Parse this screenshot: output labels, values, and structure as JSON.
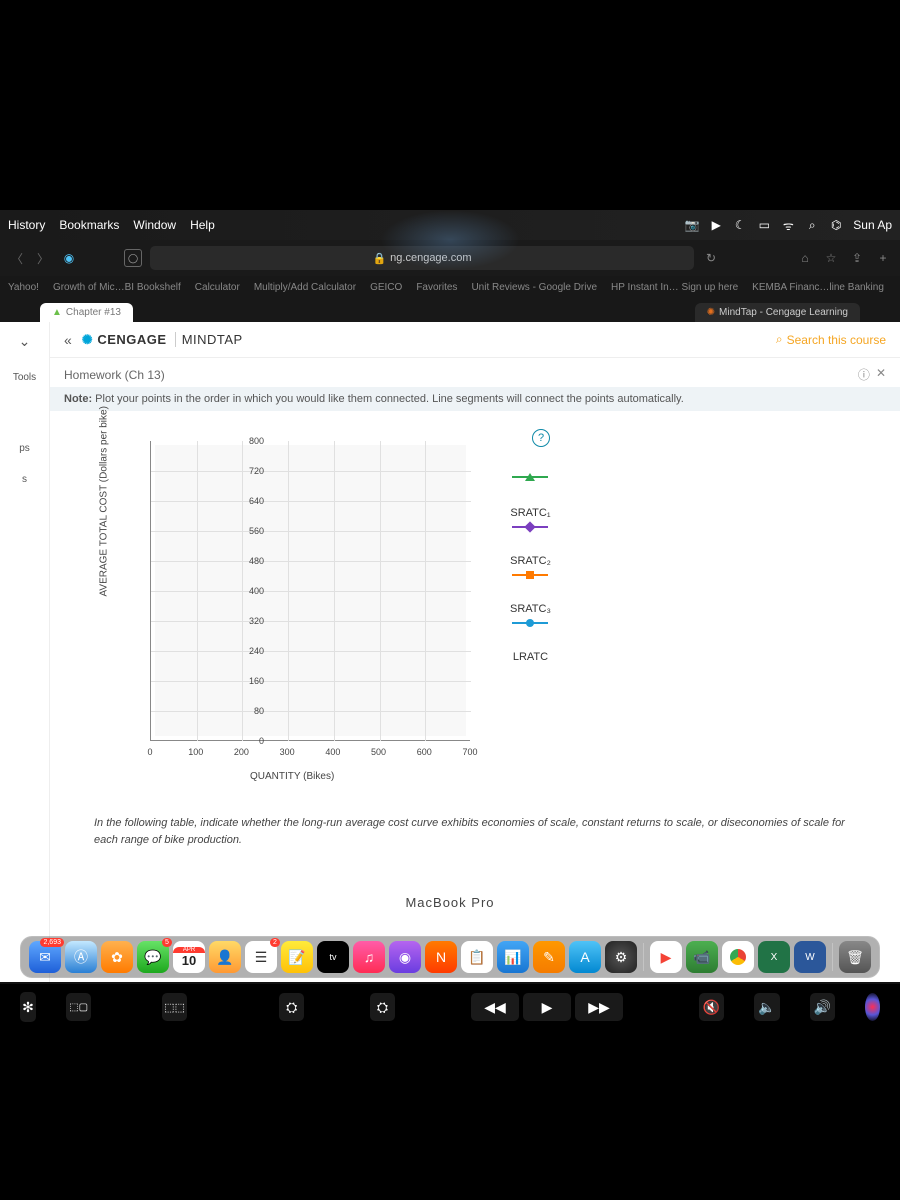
{
  "menubar": {
    "items": [
      "History",
      "Bookmarks",
      "Window",
      "Help"
    ],
    "clock": "Sun Ap"
  },
  "browser": {
    "address": "ng.cengage.com",
    "lock": "🔒",
    "reload": "↻"
  },
  "bookmarks": [
    "Yahoo!",
    "Growth of Mic…BI Bookshelf",
    "Calculator",
    "Multiply/Add Calculator",
    "GEICO",
    "Favorites",
    "Unit Reviews - Google Drive",
    "HP Instant In… Sign up here",
    "KEMBA Financ…line Banking"
  ],
  "tabs": {
    "active": "Chapter #13",
    "second": "MindTap - Cengage Learning"
  },
  "mindtap": {
    "brand_left": "CENGAGE",
    "brand_right": "MINDTAP",
    "search": "Search this course"
  },
  "sidebar": {
    "tools": "Tools",
    "label1": "ps",
    "label2": "s"
  },
  "homework": {
    "title": "Homework (Ch 13)",
    "note_label": "Note:",
    "note_text": " Plot your points in the order in which you would like them connected. Line segments will connect the points automatically."
  },
  "chart_data": {
    "type": "scatter",
    "title": "",
    "xlabel": "QUANTITY (Bikes)",
    "ylabel": "AVERAGE TOTAL COST (Dollars per bike)",
    "xlim": [
      0,
      700
    ],
    "ylim": [
      0,
      800
    ],
    "x_ticks": [
      0,
      100,
      200,
      300,
      400,
      500,
      600,
      700
    ],
    "y_ticks": [
      0,
      80,
      160,
      240,
      320,
      400,
      480,
      560,
      640,
      720,
      800
    ],
    "series": [
      {
        "name": "",
        "marker": "triangle",
        "color": "#2fa84f"
      },
      {
        "name": "SRATC₁",
        "marker": "diamond",
        "color": "#7b3fbf"
      },
      {
        "name": "SRATC₂",
        "marker": "square",
        "color": "#ff7a00"
      },
      {
        "name": "SRATC₃",
        "marker": "circle",
        "color": "#1e9bd6"
      },
      {
        "name": "LRATC",
        "marker": "none",
        "color": "#333"
      }
    ]
  },
  "legend": {
    "blank": "",
    "s1": "SRATC₁",
    "s2": "SRATC₂",
    "s3": "SRATC₃",
    "s4": "LRATC"
  },
  "followup": "In the following table, indicate whether the long-run average cost curve exhibits economies of scale, constant returns to scale, or diseconomies of scale for each range of bike production.",
  "dock": {
    "mail_badge": "2,693",
    "msg_badge": "5",
    "cal_month": "APR",
    "cal_day": "10",
    "reminders_badge": "2",
    "tv_label": "tv"
  },
  "hardware": "MacBook Pro"
}
